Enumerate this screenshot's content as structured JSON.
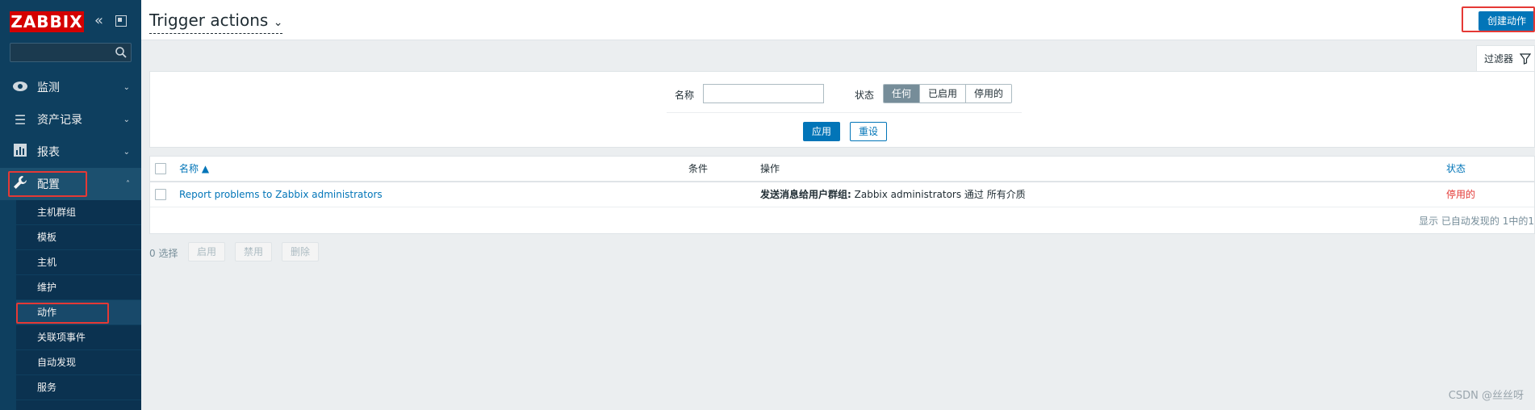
{
  "sidebar": {
    "logo": "ZABBIX",
    "collapse_icon": "double-chevron-left-icon",
    "kiosk_icon": "kiosk-mode-icon",
    "search_placeholder": "",
    "menu": [
      {
        "label": "监测",
        "icon": "eye-icon"
      },
      {
        "label": "资产记录",
        "icon": "list-icon"
      },
      {
        "label": "报表",
        "icon": "bar-chart-icon"
      },
      {
        "label": "配置",
        "icon": "wrench-icon"
      }
    ],
    "submenu": [
      "主机群组",
      "模板",
      "主机",
      "维护",
      "动作",
      "关联项事件",
      "自动发现",
      "服务"
    ]
  },
  "header": {
    "title": "Trigger actions",
    "create_button": "创建动作"
  },
  "filter": {
    "tab_label": "过滤器",
    "name_label": "名称",
    "name_value": "",
    "status_label": "状态",
    "status_options": [
      "任何",
      "已启用",
      "停用的"
    ],
    "status_selected": "任何",
    "apply": "应用",
    "reset": "重设"
  },
  "table": {
    "headers": {
      "name": "名称 ▲",
      "conditions": "条件",
      "operations": "操作",
      "status": "状态"
    },
    "rows": [
      {
        "name": "Report problems to Zabbix administrators",
        "conditions": "",
        "operations_bold": "发送消息给用户群组:",
        "operations_text": " Zabbix administrators 通过 所有介质",
        "status": "停用的"
      }
    ],
    "footer": "显示 已自动发现的 1中的1"
  },
  "actions": {
    "selected": "0 选择",
    "enable": "启用",
    "disable": "禁用",
    "delete": "删除"
  },
  "watermark": "CSDN @丝丝呀",
  "colors": {
    "sidebar": "#0e3f5f",
    "accent": "#0275b8",
    "logo": "#d40000",
    "disabled_status": "#e33734",
    "highlight_box": "#e53935"
  }
}
